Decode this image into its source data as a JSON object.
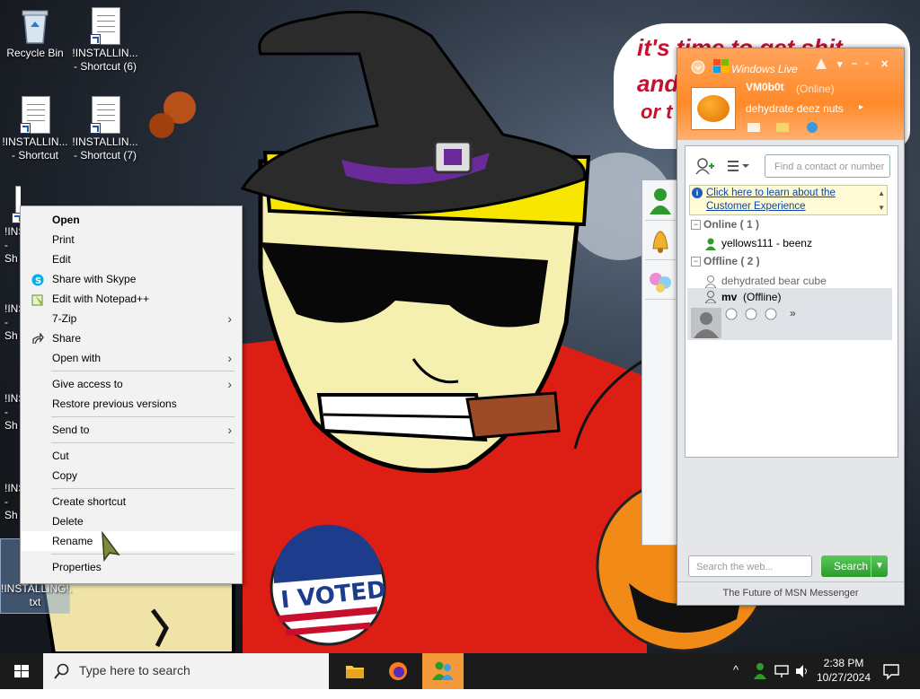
{
  "desktop": {
    "icons": [
      {
        "label": "Recycle Bin"
      },
      {
        "label": "!INSTALLIN...\n- Shortcut (6)"
      },
      {
        "label": "!INSTALLIN...\n- Shortcut"
      },
      {
        "label": "!INSTALLIN...\n- Shortcut (7)"
      },
      {
        "label": "!INSTALLING!.\ntxt"
      }
    ],
    "partial_labels": [
      "!INS",
      "- Sh"
    ]
  },
  "wallpaper": {
    "bubble_lines": [
      "it's time to get shit",
      "and",
      "or t"
    ],
    "badge_text": "I VOTED"
  },
  "context_menu": {
    "items": [
      {
        "label": "Open"
      },
      {
        "label": "Print"
      },
      {
        "label": "Edit"
      },
      {
        "label": "Share with Skype"
      },
      {
        "label": "Edit with Notepad++"
      },
      {
        "label": "7-Zip"
      },
      {
        "label": "Share"
      },
      {
        "label": "Open with"
      },
      {
        "label": "Give access to"
      },
      {
        "label": "Restore previous versions"
      },
      {
        "label": "Send to"
      },
      {
        "label": "Cut"
      },
      {
        "label": "Copy"
      },
      {
        "label": "Create shortcut"
      },
      {
        "label": "Delete"
      },
      {
        "label": "Rename"
      },
      {
        "label": "Properties"
      }
    ],
    "submenu_glyph": "›"
  },
  "messenger": {
    "title": "Windows Live",
    "user_name": "VM0b0t",
    "user_status": "(Online)",
    "personal_message": "dehydrate deez nuts",
    "search_contact_placeholder": "Find a contact or number",
    "customer_experience_link": "Click here to learn about the\nCustomer Experience",
    "online_group": "Online ( 1 )",
    "online_contacts": [
      "yellows111 - beenz"
    ],
    "offline_group": "Offline ( 2 )",
    "offline_contacts": [
      "dehydrated bear cube"
    ],
    "selected_contact": {
      "name": "mv",
      "status": "(Offline)"
    },
    "web_search_placeholder": "Search the web...",
    "search_button": "Search",
    "footer": "The Future of MSN Messenger",
    "more_glyph": "»"
  },
  "taskbar": {
    "search_placeholder": "Type here to search",
    "time": "2:38 PM",
    "date": "10/27/2024"
  },
  "colors": {
    "messenger_orange": "#ff8a2a",
    "taskbar": "#1b1b1b",
    "online_green": "#2c9a2c",
    "link_blue": "#0645ad"
  }
}
